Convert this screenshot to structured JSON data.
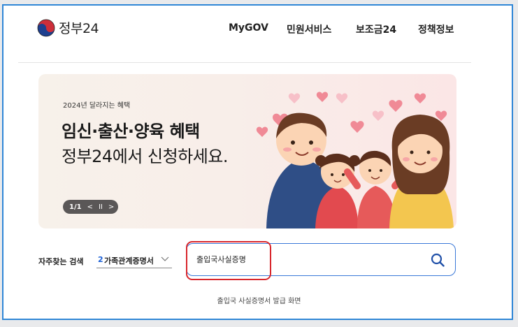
{
  "header": {
    "logo_text": "정부24",
    "nav": [
      "MyGOV",
      "민원서비스",
      "보조금24",
      "정책정보"
    ]
  },
  "banner": {
    "eyebrow": "2024년 달라지는 혜택",
    "title": "임신·출산·양육 혜택",
    "subtitle": "정부24에서 신청하세요.",
    "pager_count": "1/1",
    "pager_prev": "<",
    "pager_pause": "II",
    "pager_next": ">"
  },
  "search": {
    "favorites_label": "자주찾는 검색",
    "favorite_index": "2",
    "favorite_text": "가족관계증명서",
    "query": "출입국사실증명"
  },
  "caption": "출입국 사실증명서 발급 화면",
  "colors": {
    "frame": "#2f86d6",
    "search_border": "#3a78d8",
    "highlight": "#d8262c",
    "pager_bg": "#5a5757"
  },
  "icons": {
    "logo": "taegeuk-logo-icon",
    "select_chevron": "chevron-down-icon",
    "search": "search-icon"
  }
}
